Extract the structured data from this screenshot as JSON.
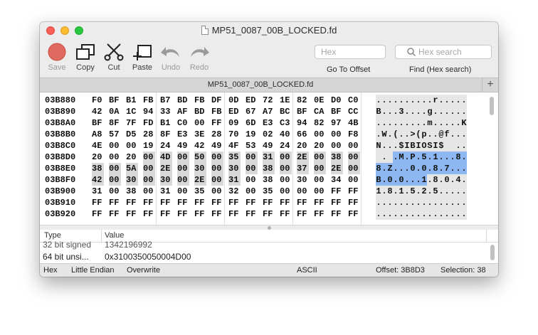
{
  "window": {
    "title": "MP51_0087_00B_LOCKED.fd"
  },
  "toolbar": {
    "buttons": [
      {
        "label": "Save",
        "icon": "save-icon",
        "enabled": false
      },
      {
        "label": "Copy",
        "icon": "copy-icon",
        "enabled": true
      },
      {
        "label": "Cut",
        "icon": "scissors-icon",
        "enabled": true
      },
      {
        "label": "Paste",
        "icon": "paste-icon",
        "enabled": true
      },
      {
        "label": "Undo",
        "icon": "undo-icon",
        "enabled": false
      },
      {
        "label": "Redo",
        "icon": "redo-icon",
        "enabled": false
      }
    ],
    "goto": {
      "placeholder": "Hex",
      "label": "Go To Offset"
    },
    "find": {
      "placeholder": "Hex search",
      "label": "Find (Hex search)"
    }
  },
  "tab": {
    "title": "MP51_0087_00B_LOCKED.fd",
    "add": "+"
  },
  "hex": {
    "selection_start_offset": "03B8D3",
    "selection_length": 38,
    "rows": [
      {
        "offset": "03B880",
        "bytes": [
          "F0",
          "BF",
          "B1",
          "FB",
          "B7",
          "BD",
          "FB",
          "DF",
          "0D",
          "ED",
          "72",
          "1E",
          "82",
          "0E",
          "D0",
          "C0"
        ],
        "ascii": "..........r....."
      },
      {
        "offset": "03B890",
        "bytes": [
          "42",
          "0A",
          "1C",
          "94",
          "33",
          "AF",
          "BD",
          "FB",
          "ED",
          "67",
          "A7",
          "BC",
          "BF",
          "CA",
          "BF",
          "CC"
        ],
        "ascii": "B...3....g......"
      },
      {
        "offset": "03B8A0",
        "bytes": [
          "BF",
          "8F",
          "7F",
          "FD",
          "B1",
          "C0",
          "00",
          "FF",
          "09",
          "6D",
          "E3",
          "C3",
          "94",
          "82",
          "97",
          "4B"
        ],
        "ascii": ".........m.....K"
      },
      {
        "offset": "03B8B0",
        "bytes": [
          "A8",
          "57",
          "D5",
          "28",
          "8F",
          "E3",
          "3E",
          "28",
          "70",
          "19",
          "02",
          "40",
          "66",
          "00",
          "00",
          "F8"
        ],
        "ascii": ".W.(..>(p..@f..."
      },
      {
        "offset": "03B8C0",
        "bytes": [
          "4E",
          "00",
          "00",
          "19",
          "24",
          "49",
          "42",
          "49",
          "4F",
          "53",
          "49",
          "24",
          "20",
          "20",
          "00",
          "00"
        ],
        "ascii": "N...$IBIOSI$  .."
      },
      {
        "offset": "03B8D0",
        "bytes": [
          "20",
          "00",
          "20",
          "00",
          "4D",
          "00",
          "50",
          "00",
          "35",
          "00",
          "31",
          "00",
          "2E",
          "00",
          "38",
          "00"
        ],
        "ascii": " . .M.P.5.1...8."
      },
      {
        "offset": "03B8E0",
        "bytes": [
          "38",
          "00",
          "5A",
          "00",
          "2E",
          "00",
          "30",
          "00",
          "30",
          "00",
          "38",
          "00",
          "37",
          "00",
          "2E",
          "00"
        ],
        "ascii": "8.Z...0.0.8.7..."
      },
      {
        "offset": "03B8F0",
        "bytes": [
          "42",
          "00",
          "30",
          "00",
          "30",
          "00",
          "2E",
          "00",
          "31",
          "00",
          "38",
          "00",
          "30",
          "00",
          "34",
          "00"
        ],
        "ascii": "B.0.0...1.8.0.4."
      },
      {
        "offset": "03B900",
        "bytes": [
          "31",
          "00",
          "38",
          "00",
          "31",
          "00",
          "35",
          "00",
          "32",
          "00",
          "35",
          "00",
          "00",
          "00",
          "FF",
          "FF"
        ],
        "ascii": "1.8.1.5.2.5....."
      },
      {
        "offset": "03B910",
        "bytes": [
          "FF",
          "FF",
          "FF",
          "FF",
          "FF",
          "FF",
          "FF",
          "FF",
          "FF",
          "FF",
          "FF",
          "FF",
          "FF",
          "FF",
          "FF",
          "FF"
        ],
        "ascii": "................"
      },
      {
        "offset": "03B920",
        "bytes": [
          "FF",
          "FF",
          "FF",
          "FF",
          "FF",
          "FF",
          "FF",
          "FF",
          "FF",
          "FF",
          "FF",
          "FF",
          "FF",
          "FF",
          "FF",
          "FF"
        ],
        "ascii": "................"
      }
    ]
  },
  "inspector": {
    "headers": {
      "type": "Type",
      "value": "Value"
    },
    "rows": [
      {
        "type": "32 bit signed",
        "value": "1342196992"
      },
      {
        "type": "64 bit unsi...",
        "value": "0x3100350050004D00"
      }
    ]
  },
  "status": {
    "mode": "Hex",
    "endian": "Little Endian",
    "edit_mode": "Overwrite",
    "encoding": "ASCII",
    "offset": "Offset: 3B8D3",
    "selection": "Selection: 38"
  },
  "colors": {
    "selection_blue": "#8db7f0",
    "selection_gray": "#d8d8d8",
    "close": "#fc5f57",
    "minimize": "#fdbc2e",
    "maximize": "#28c840"
  }
}
